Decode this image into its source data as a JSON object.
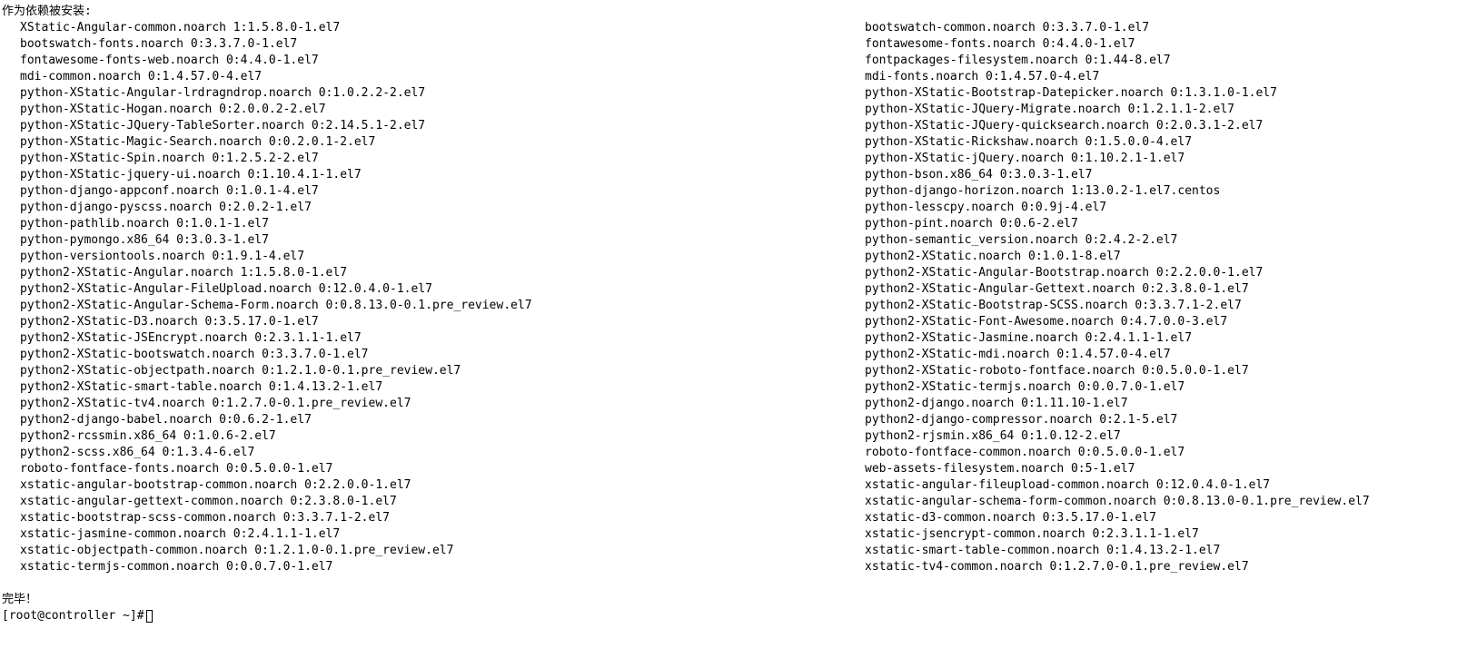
{
  "header": "作为依赖被安装:",
  "col1": [
    "XStatic-Angular-common.noarch 1:1.5.8.0-1.el7",
    "bootswatch-fonts.noarch 0:3.3.7.0-1.el7",
    "fontawesome-fonts-web.noarch 0:4.4.0-1.el7",
    "mdi-common.noarch 0:1.4.57.0-4.el7",
    "python-XStatic-Angular-lrdragndrop.noarch 0:1.0.2.2-2.el7",
    "python-XStatic-Hogan.noarch 0:2.0.0.2-2.el7",
    "python-XStatic-JQuery-TableSorter.noarch 0:2.14.5.1-2.el7",
    "python-XStatic-Magic-Search.noarch 0:0.2.0.1-2.el7",
    "python-XStatic-Spin.noarch 0:1.2.5.2-2.el7",
    "python-XStatic-jquery-ui.noarch 0:1.10.4.1-1.el7",
    "python-django-appconf.noarch 0:1.0.1-4.el7",
    "python-django-pyscss.noarch 0:2.0.2-1.el7",
    "python-pathlib.noarch 0:1.0.1-1.el7",
    "python-pymongo.x86_64 0:3.0.3-1.el7",
    "python-versiontools.noarch 0:1.9.1-4.el7",
    "python2-XStatic-Angular.noarch 1:1.5.8.0-1.el7",
    "python2-XStatic-Angular-FileUpload.noarch 0:12.0.4.0-1.el7",
    "python2-XStatic-Angular-Schema-Form.noarch 0:0.8.13.0-0.1.pre_review.el7",
    "python2-XStatic-D3.noarch 0:3.5.17.0-1.el7",
    "python2-XStatic-JSEncrypt.noarch 0:2.3.1.1-1.el7",
    "python2-XStatic-bootswatch.noarch 0:3.3.7.0-1.el7",
    "python2-XStatic-objectpath.noarch 0:1.2.1.0-0.1.pre_review.el7",
    "python2-XStatic-smart-table.noarch 0:1.4.13.2-1.el7",
    "python2-XStatic-tv4.noarch 0:1.2.7.0-0.1.pre_review.el7",
    "python2-django-babel.noarch 0:0.6.2-1.el7",
    "python2-rcssmin.x86_64 0:1.0.6-2.el7",
    "python2-scss.x86_64 0:1.3.4-6.el7",
    "roboto-fontface-fonts.noarch 0:0.5.0.0-1.el7",
    "xstatic-angular-bootstrap-common.noarch 0:2.2.0.0-1.el7",
    "xstatic-angular-gettext-common.noarch 0:2.3.8.0-1.el7",
    "xstatic-bootstrap-scss-common.noarch 0:3.3.7.1-2.el7",
    "xstatic-jasmine-common.noarch 0:2.4.1.1-1.el7",
    "xstatic-objectpath-common.noarch 0:1.2.1.0-0.1.pre_review.el7",
    "xstatic-termjs-common.noarch 0:0.0.7.0-1.el7"
  ],
  "col2": [
    "bootswatch-common.noarch 0:3.3.7.0-1.el7",
    "fontawesome-fonts.noarch 0:4.4.0-1.el7",
    "fontpackages-filesystem.noarch 0:1.44-8.el7",
    "mdi-fonts.noarch 0:1.4.57.0-4.el7",
    "python-XStatic-Bootstrap-Datepicker.noarch 0:1.3.1.0-1.el7",
    "python-XStatic-JQuery-Migrate.noarch 0:1.2.1.1-2.el7",
    "python-XStatic-JQuery-quicksearch.noarch 0:2.0.3.1-2.el7",
    "python-XStatic-Rickshaw.noarch 0:1.5.0.0-4.el7",
    "python-XStatic-jQuery.noarch 0:1.10.2.1-1.el7",
    "python-bson.x86_64 0:3.0.3-1.el7",
    "python-django-horizon.noarch 1:13.0.2-1.el7.centos",
    "python-lesscpy.noarch 0:0.9j-4.el7",
    "python-pint.noarch 0:0.6-2.el7",
    "python-semantic_version.noarch 0:2.4.2-2.el7",
    "python2-XStatic.noarch 0:1.0.1-8.el7",
    "python2-XStatic-Angular-Bootstrap.noarch 0:2.2.0.0-1.el7",
    "python2-XStatic-Angular-Gettext.noarch 0:2.3.8.0-1.el7",
    "python2-XStatic-Bootstrap-SCSS.noarch 0:3.3.7.1-2.el7",
    "python2-XStatic-Font-Awesome.noarch 0:4.7.0.0-3.el7",
    "python2-XStatic-Jasmine.noarch 0:2.4.1.1-1.el7",
    "python2-XStatic-mdi.noarch 0:1.4.57.0-4.el7",
    "python2-XStatic-roboto-fontface.noarch 0:0.5.0.0-1.el7",
    "python2-XStatic-termjs.noarch 0:0.0.7.0-1.el7",
    "python2-django.noarch 0:1.11.10-1.el7",
    "python2-django-compressor.noarch 0:2.1-5.el7",
    "python2-rjsmin.x86_64 0:1.0.12-2.el7",
    "roboto-fontface-common.noarch 0:0.5.0.0-1.el7",
    "web-assets-filesystem.noarch 0:5-1.el7",
    "xstatic-angular-fileupload-common.noarch 0:12.0.4.0-1.el7",
    "xstatic-angular-schema-form-common.noarch 0:0.8.13.0-0.1.pre_review.el7",
    "xstatic-d3-common.noarch 0:3.5.17.0-1.el7",
    "xstatic-jsencrypt-common.noarch 0:2.3.1.1-1.el7",
    "xstatic-smart-table-common.noarch 0:1.4.13.2-1.el7",
    "xstatic-tv4-common.noarch 0:1.2.7.0-0.1.pre_review.el7"
  ],
  "footer_done": "完毕！",
  "prompt": "[root@controller ~]# "
}
